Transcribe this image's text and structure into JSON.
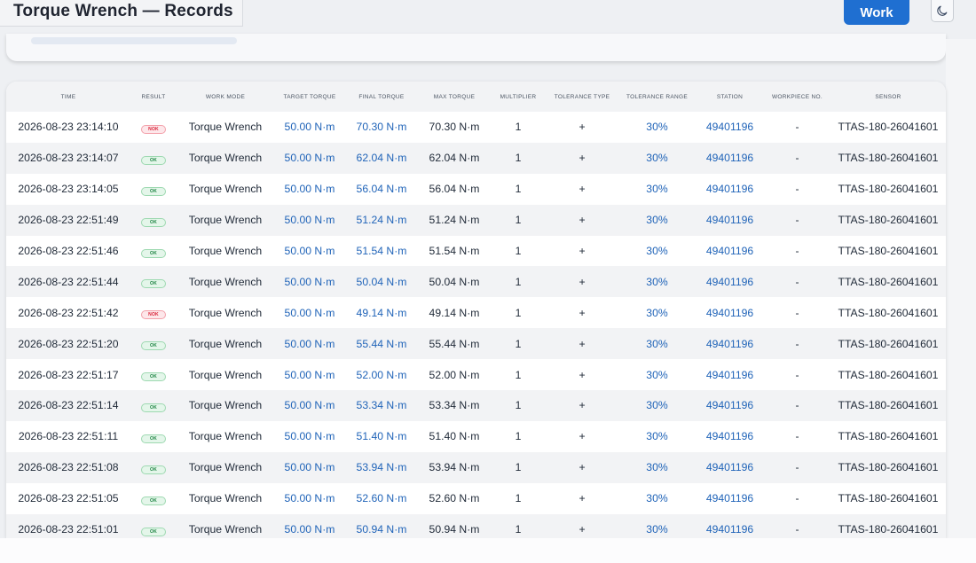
{
  "header": {
    "title": "Torque Wrench — Records",
    "work_label": "Work",
    "theme_icon": "moon-icon"
  },
  "table": {
    "columns": [
      "TIME",
      "RESULT",
      "WORK MODE",
      "TARGET TORQUE",
      "FINAL TORQUE",
      "MAX TORQUE",
      "MULTIPLIER",
      "TOLERANCE TYPE",
      "TOLERANCE RANGE",
      "STATION",
      "WORKPIECE NO.",
      "SENSOR"
    ],
    "rows": [
      {
        "time": "2026-08-23 23:14:10",
        "result": "NOK",
        "mode": "Torque Wrench",
        "target": "50.00 N·m",
        "final": "70.30 N·m",
        "max": "70.30 N·m",
        "multiplier": "1",
        "tol_type": "+",
        "tol_range": "30%",
        "station": "49401196",
        "workpiece": "-",
        "sensor": "TTAS-180-26041601"
      },
      {
        "time": "2026-08-23 23:14:07",
        "result": "OK",
        "mode": "Torque Wrench",
        "target": "50.00 N·m",
        "final": "62.04 N·m",
        "max": "62.04 N·m",
        "multiplier": "1",
        "tol_type": "+",
        "tol_range": "30%",
        "station": "49401196",
        "workpiece": "-",
        "sensor": "TTAS-180-26041601"
      },
      {
        "time": "2026-08-23 23:14:05",
        "result": "OK",
        "mode": "Torque Wrench",
        "target": "50.00 N·m",
        "final": "56.04 N·m",
        "max": "56.04 N·m",
        "multiplier": "1",
        "tol_type": "+",
        "tol_range": "30%",
        "station": "49401196",
        "workpiece": "-",
        "sensor": "TTAS-180-26041601"
      },
      {
        "time": "2026-08-23 22:51:49",
        "result": "OK",
        "mode": "Torque Wrench",
        "target": "50.00 N·m",
        "final": "51.24 N·m",
        "max": "51.24 N·m",
        "multiplier": "1",
        "tol_type": "+",
        "tol_range": "30%",
        "station": "49401196",
        "workpiece": "-",
        "sensor": "TTAS-180-26041601"
      },
      {
        "time": "2026-08-23 22:51:46",
        "result": "OK",
        "mode": "Torque Wrench",
        "target": "50.00 N·m",
        "final": "51.54 N·m",
        "max": "51.54 N·m",
        "multiplier": "1",
        "tol_type": "+",
        "tol_range": "30%",
        "station": "49401196",
        "workpiece": "-",
        "sensor": "TTAS-180-26041601"
      },
      {
        "time": "2026-08-23 22:51:44",
        "result": "OK",
        "mode": "Torque Wrench",
        "target": "50.00 N·m",
        "final": "50.04 N·m",
        "max": "50.04 N·m",
        "multiplier": "1",
        "tol_type": "+",
        "tol_range": "30%",
        "station": "49401196",
        "workpiece": "-",
        "sensor": "TTAS-180-26041601"
      },
      {
        "time": "2026-08-23 22:51:42",
        "result": "NOK",
        "mode": "Torque Wrench",
        "target": "50.00 N·m",
        "final": "49.14 N·m",
        "max": "49.14 N·m",
        "multiplier": "1",
        "tol_type": "+",
        "tol_range": "30%",
        "station": "49401196",
        "workpiece": "-",
        "sensor": "TTAS-180-26041601"
      },
      {
        "time": "2026-08-23 22:51:20",
        "result": "OK",
        "mode": "Torque Wrench",
        "target": "50.00 N·m",
        "final": "55.44 N·m",
        "max": "55.44 N·m",
        "multiplier": "1",
        "tol_type": "+",
        "tol_range": "30%",
        "station": "49401196",
        "workpiece": "-",
        "sensor": "TTAS-180-26041601"
      },
      {
        "time": "2026-08-23 22:51:17",
        "result": "OK",
        "mode": "Torque Wrench",
        "target": "50.00 N·m",
        "final": "52.00 N·m",
        "max": "52.00 N·m",
        "multiplier": "1",
        "tol_type": "+",
        "tol_range": "30%",
        "station": "49401196",
        "workpiece": "-",
        "sensor": "TTAS-180-26041601"
      },
      {
        "time": "2026-08-23 22:51:14",
        "result": "OK",
        "mode": "Torque Wrench",
        "target": "50.00 N·m",
        "final": "53.34 N·m",
        "max": "53.34 N·m",
        "multiplier": "1",
        "tol_type": "+",
        "tol_range": "30%",
        "station": "49401196",
        "workpiece": "-",
        "sensor": "TTAS-180-26041601"
      },
      {
        "time": "2026-08-23 22:51:11",
        "result": "OK",
        "mode": "Torque Wrench",
        "target": "50.00 N·m",
        "final": "51.40 N·m",
        "max": "51.40 N·m",
        "multiplier": "1",
        "tol_type": "+",
        "tol_range": "30%",
        "station": "49401196",
        "workpiece": "-",
        "sensor": "TTAS-180-26041601"
      },
      {
        "time": "2026-08-23 22:51:08",
        "result": "OK",
        "mode": "Torque Wrench",
        "target": "50.00 N·m",
        "final": "53.94 N·m",
        "max": "53.94 N·m",
        "multiplier": "1",
        "tol_type": "+",
        "tol_range": "30%",
        "station": "49401196",
        "workpiece": "-",
        "sensor": "TTAS-180-26041601"
      },
      {
        "time": "2026-08-23 22:51:05",
        "result": "OK",
        "mode": "Torque Wrench",
        "target": "50.00 N·m",
        "final": "52.60 N·m",
        "max": "52.60 N·m",
        "multiplier": "1",
        "tol_type": "+",
        "tol_range": "30%",
        "station": "49401196",
        "workpiece": "-",
        "sensor": "TTAS-180-26041601"
      },
      {
        "time": "2026-08-23 22:51:01",
        "result": "OK",
        "mode": "Torque Wrench",
        "target": "50.00 N·m",
        "final": "50.94 N·m",
        "max": "50.94 N·m",
        "multiplier": "1",
        "tol_type": "+",
        "tol_range": "30%",
        "station": "49401196",
        "workpiece": "-",
        "sensor": "TTAS-180-26041601"
      }
    ]
  },
  "colors": {
    "accent": "#1f6fd1",
    "link": "#1f63b8",
    "ok": "#16803c",
    "nok": "#d92136"
  }
}
